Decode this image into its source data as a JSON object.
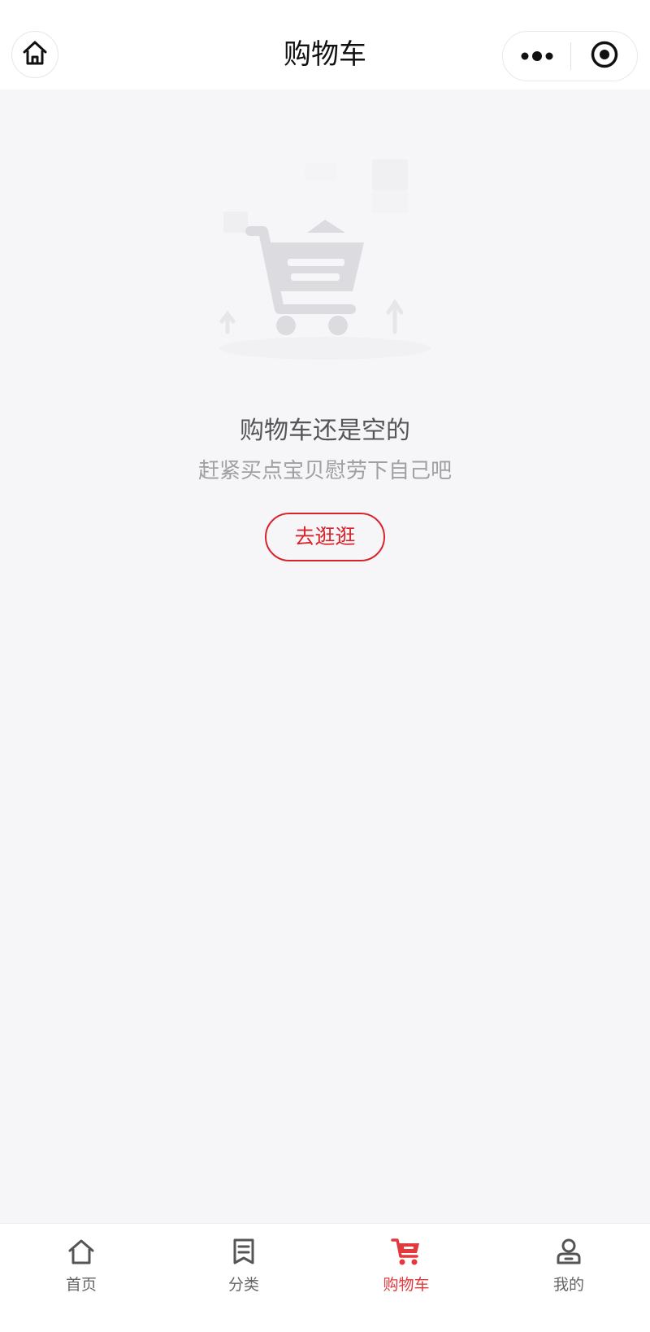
{
  "header": {
    "title": "购物车",
    "home_icon": "home-icon",
    "more_icon": "more-dots-icon",
    "close_icon": "target-close-icon"
  },
  "empty_state": {
    "illustration_icon": "empty-cart-illustration",
    "title": "购物车还是空的",
    "subtitle": "赶紧买点宝贝慰劳下自己吧",
    "button_label": "去逛逛"
  },
  "tabbar": {
    "items": [
      {
        "label": "首页",
        "icon": "home-icon",
        "active": false
      },
      {
        "label": "分类",
        "icon": "list-icon",
        "active": false
      },
      {
        "label": "购物车",
        "icon": "cart-icon",
        "active": true
      },
      {
        "label": "我的",
        "icon": "user-icon",
        "active": false
      }
    ]
  },
  "colors": {
    "accent": "#e4393c",
    "button_border": "#d7242a",
    "background": "#f6f6f8"
  }
}
